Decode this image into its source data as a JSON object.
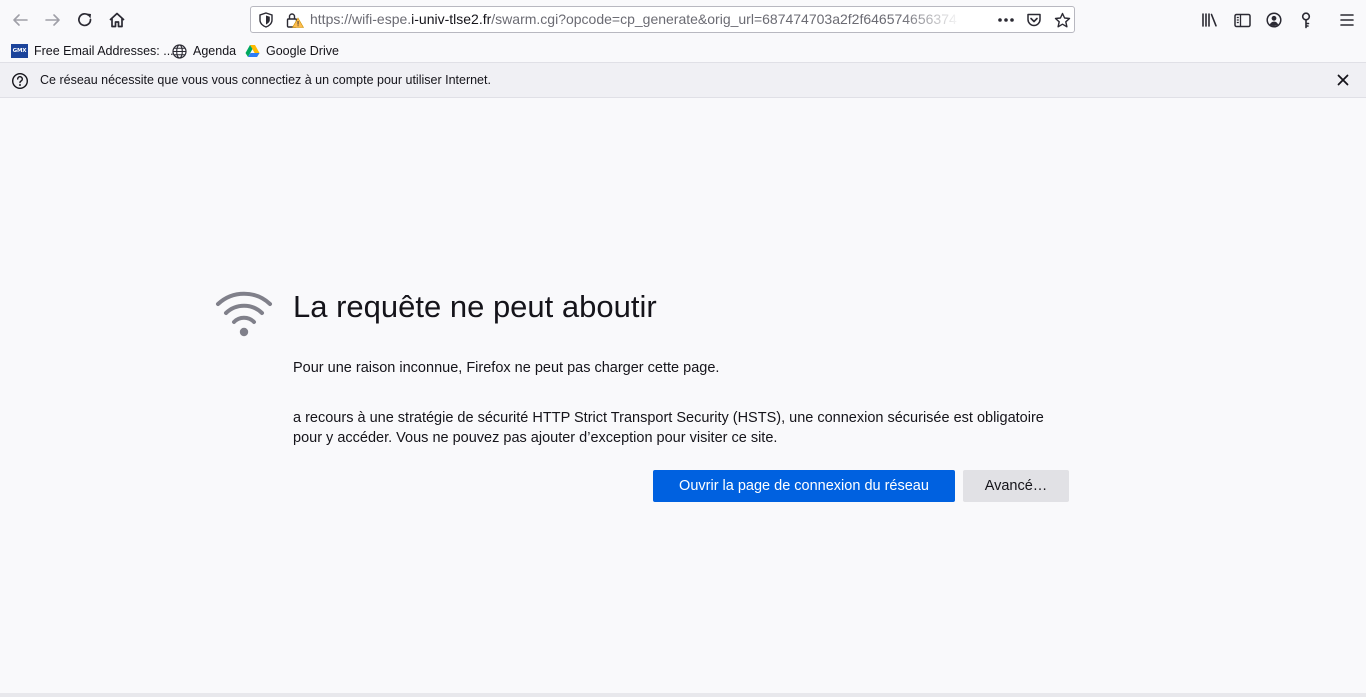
{
  "toolbar": {
    "back_icon": "arrow-left-icon",
    "forward_icon": "arrow-right-icon",
    "reload_icon": "reload-icon",
    "home_icon": "home-icon",
    "url": {
      "prefix": "https://wifi-espe.",
      "domain": "i-univ-tlse2.fr",
      "path": "/swarm.cgi?opcode=cp_generate&orig_url=687474703a2f2f646574656374"
    },
    "page_actions_icon": "ellipsis-icon",
    "pocket_icon": "pocket-icon",
    "bookmark_star_icon": "star-icon",
    "library_icon": "library-icon",
    "sidebar_icon": "sidebar-icon",
    "account_icon": "account-icon",
    "passwords_icon": "key-icon",
    "menu_icon": "hamburger-menu-icon"
  },
  "bookmarks": [
    {
      "label": "Free Email Addresses: ...",
      "icon": "gmx-favicon",
      "icon_text": "GMX"
    },
    {
      "label": "Agenda",
      "icon": "globe-icon"
    },
    {
      "label": "Google Drive",
      "icon": "google-drive-icon"
    }
  ],
  "notification": {
    "text": "Ce réseau nécessite que vous vous connectiez à un compte pour utiliser Internet.",
    "icon": "question-circle-icon",
    "close_icon": "close-icon"
  },
  "error_page": {
    "icon": "wifi-icon",
    "title": "La requête ne peut aboutir",
    "description": "Pour une raison inconnue, Firefox ne peut pas charger cette page.",
    "hsts_text": "a recours à une stratégie de sécurité HTTP Strict Transport Security (HSTS), une connexion sécurisée est obligatoire pour y accéder. Vous ne pouvez pas ajouter d’exception pour visiter ce site.",
    "primary_button": "Ouvrir la page de connexion du réseau",
    "secondary_button": "Avancé…"
  },
  "colors": {
    "primary_button": "#0061e0",
    "page_background": "#f9f9fb",
    "notification_background": "#f0f0f4"
  }
}
